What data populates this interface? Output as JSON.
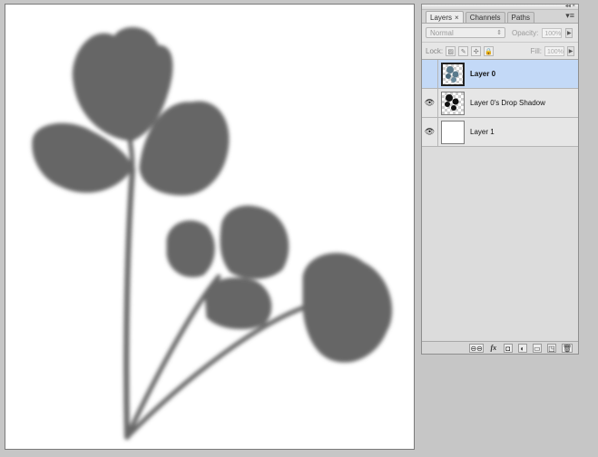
{
  "canvas": {
    "background": "#ffffff",
    "silhouette_color": "#666666"
  },
  "layers_panel": {
    "tabs": [
      {
        "label": "Layers",
        "active": true,
        "close": "×"
      },
      {
        "label": "Channels",
        "active": false
      },
      {
        "label": "Paths",
        "active": false
      }
    ],
    "menu_icon": "▾≡",
    "collapse_icon": "◂◂ ×",
    "blend_mode": "Normal",
    "opacity_label": "Opacity:",
    "opacity_value": "100%",
    "lock_label": "Lock:",
    "fill_label": "Fill:",
    "fill_value": "100%",
    "layers": [
      {
        "name": "Layer 0",
        "visible": false,
        "selected": true
      },
      {
        "name": "Layer 0's Drop Shadow",
        "visible": true,
        "selected": false
      },
      {
        "name": "Layer 1",
        "visible": true,
        "selected": false
      }
    ],
    "eye_glyph": "👁",
    "footer_buttons": [
      {
        "name": "link-layers-button",
        "glyph": "⊖⊖"
      },
      {
        "name": "fx-button",
        "glyph": "fx"
      },
      {
        "name": "add-mask-button",
        "glyph": "◘"
      },
      {
        "name": "adjustment-layer-button",
        "glyph": "◐"
      },
      {
        "name": "new-group-button",
        "glyph": "▭"
      },
      {
        "name": "new-layer-button",
        "glyph": "◳"
      },
      {
        "name": "delete-layer-button",
        "glyph": "🗑"
      }
    ]
  }
}
